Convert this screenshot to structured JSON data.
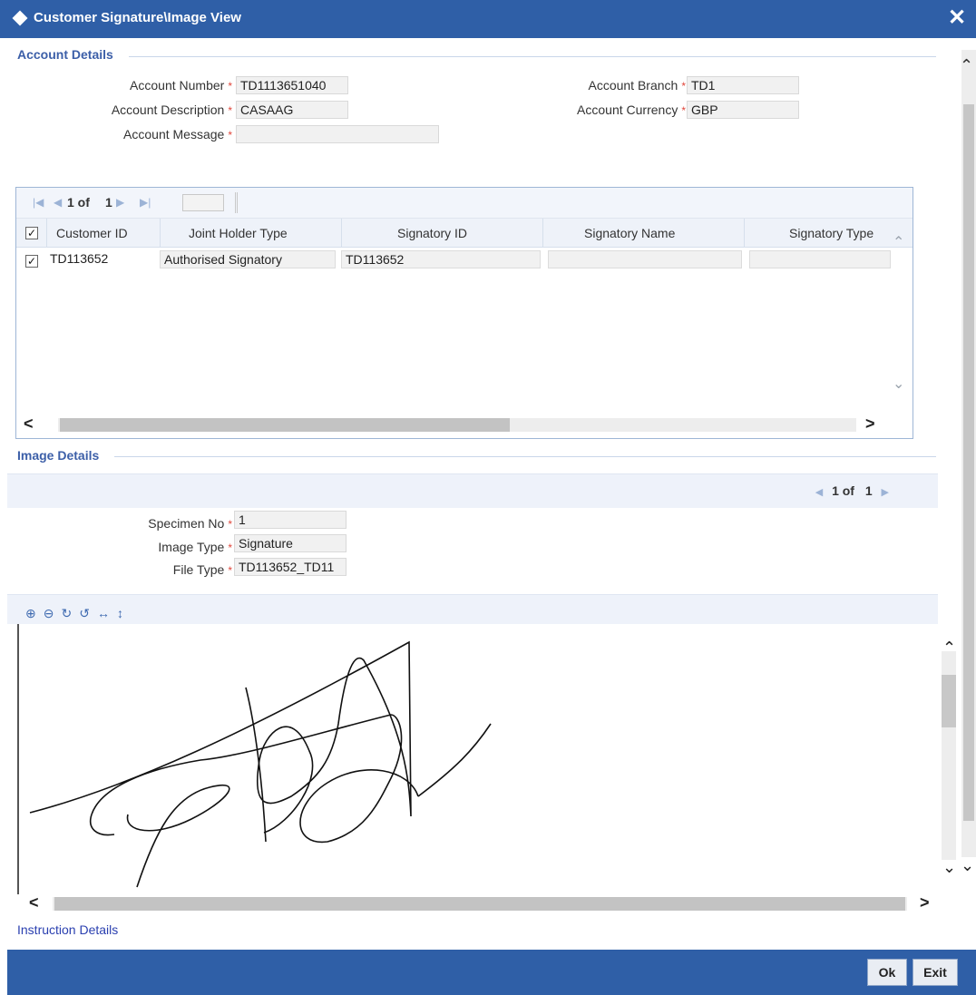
{
  "window": {
    "title": "Customer Signature\\Image View",
    "close_label": "✕"
  },
  "account_details": {
    "section_title": "Account Details",
    "account_number_label": "Account Number",
    "account_number_value": "TD1113651040",
    "account_description_label": "Account Description",
    "account_description_value": "CASAAG",
    "account_message_label": "Account Message",
    "account_message_value": "",
    "account_branch_label": "Account Branch",
    "account_branch_value": "TD1",
    "account_currency_label": "Account Currency",
    "account_currency_value": "GBP",
    "required_marker": "*"
  },
  "signatory_grid": {
    "pager_text_1": "1 of",
    "pager_text_2": "1",
    "columns": [
      "Customer ID",
      "Joint Holder Type",
      "Signatory ID",
      "Signatory Name",
      "Signatory Type"
    ],
    "header_checked": "✓",
    "rows": [
      {
        "checked": "✓",
        "customer_id": "TD113652",
        "joint_holder_type": "Authorised Signatory",
        "signatory_id": "TD113652",
        "signatory_name": "",
        "signatory_type": ""
      }
    ]
  },
  "image_details": {
    "section_title": "Image Details",
    "pager_text_1": "1 of",
    "pager_text_2": "1",
    "specimen_no_label": "Specimen No",
    "specimen_no_value": "1",
    "image_type_label": "Image Type",
    "image_type_value": "Signature",
    "file_type_label": "File Type",
    "file_type_value": "TD113652_TD11",
    "toolbar_icons": [
      "zoom-in-icon",
      "zoom-out-icon",
      "rotate-right-icon",
      "rotate-left-icon",
      "flip-horizontal-icon",
      "flip-vertical-icon"
    ]
  },
  "instruction_details_label": "Instruction Details",
  "footer": {
    "ok_label": "Ok",
    "exit_label": "Exit"
  },
  "colors": {
    "titlebar": "#2f5fa7",
    "section_title": "#3c5fa8",
    "required": "#e0463b",
    "link": "#2b40b0"
  }
}
